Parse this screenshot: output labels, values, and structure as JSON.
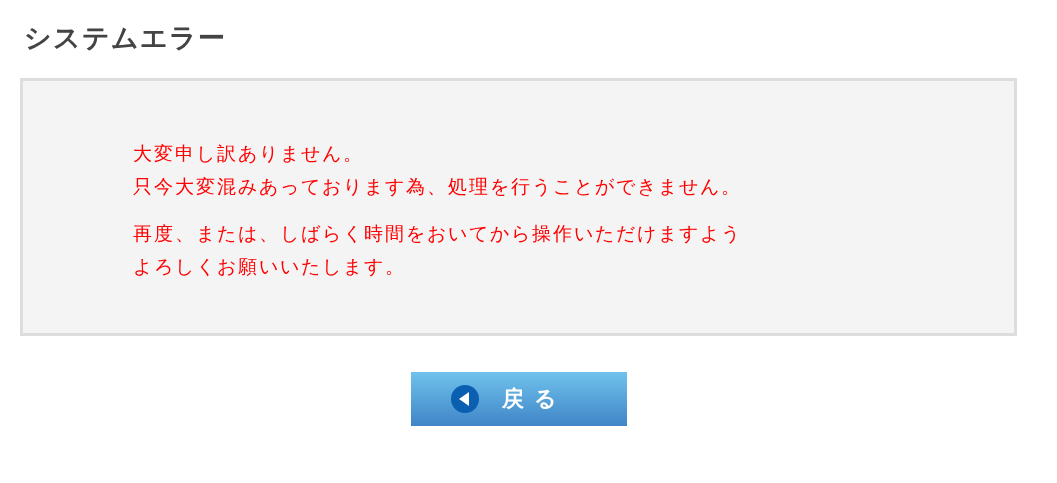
{
  "title": "システムエラー",
  "message": {
    "paragraphs": [
      {
        "lines": [
          "大変申し訳ありません。",
          "只今大変混みあっております為、処理を行うことができません。"
        ]
      },
      {
        "lines": [
          "再度、または、しばらく時間をおいてから操作いただけますよう",
          "よろしくお願いいたします。"
        ]
      }
    ]
  },
  "back_button": {
    "label": "戻る"
  }
}
